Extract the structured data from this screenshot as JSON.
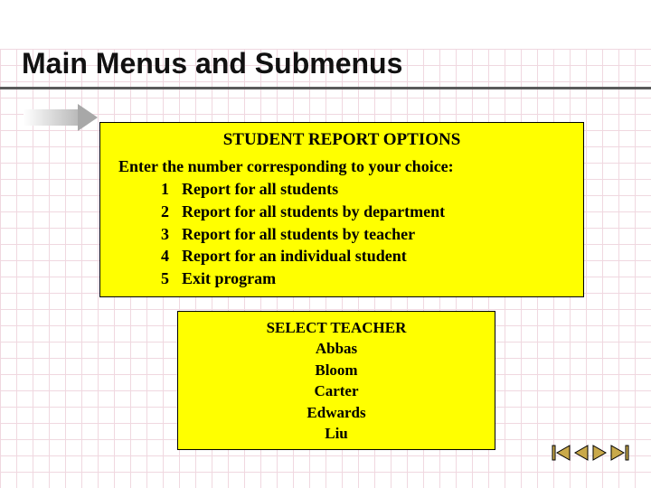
{
  "slide": {
    "title": "Main Menus and Submenus"
  },
  "panel_main": {
    "heading": "STUDENT REPORT OPTIONS",
    "prompt": "Enter the number corresponding to your choice:",
    "options": [
      {
        "num": "1",
        "label": "Report for all students"
      },
      {
        "num": "2",
        "label": "Report for all students by department"
      },
      {
        "num": "3",
        "label": "Report for all students by teacher"
      },
      {
        "num": "4",
        "label": "Report for an individual student"
      },
      {
        "num": "5",
        "label": "Exit program"
      }
    ]
  },
  "panel_sub": {
    "heading": "SELECT TEACHER",
    "items": [
      "Abbas",
      "Bloom",
      "Carter",
      "Edwards",
      "Liu"
    ]
  },
  "colors": {
    "panel_bg": "#ffff00",
    "title_underline": "#5a5a5a",
    "grid_line": "#f0d8e0"
  }
}
